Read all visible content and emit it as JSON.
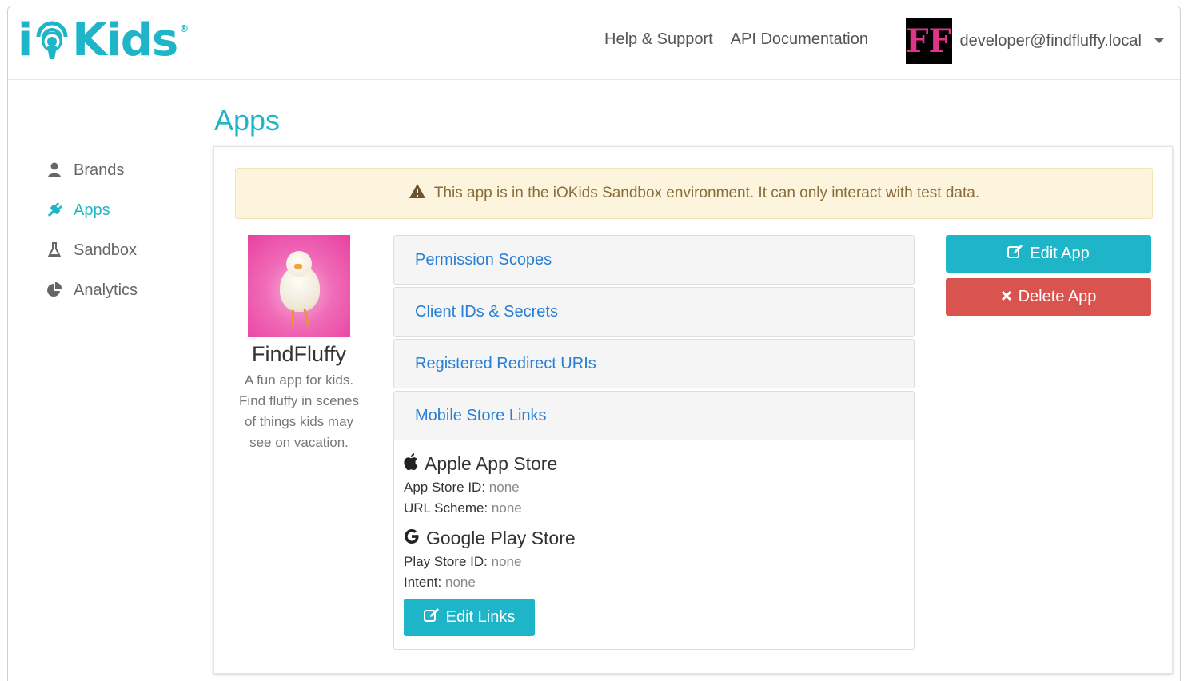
{
  "brand": {
    "logo_text_left": "i",
    "logo_text_right": "Kids",
    "logo_registered": "®",
    "accent_color": "#1fb5c8"
  },
  "header": {
    "links": [
      "Help & Support",
      "API Documentation"
    ],
    "avatar_text": "FF",
    "user_email": "developer@findfluffy.local"
  },
  "sidebar": {
    "items": [
      {
        "label": "Brands",
        "icon": "user-icon",
        "active": false
      },
      {
        "label": "Apps",
        "icon": "plug-icon",
        "active": true
      },
      {
        "label": "Sandbox",
        "icon": "flask-icon",
        "active": false
      },
      {
        "label": "Analytics",
        "icon": "pie-chart-icon",
        "active": false
      }
    ]
  },
  "page": {
    "title": "Apps"
  },
  "alert": {
    "icon": "warning-icon",
    "text": "This app is in the iOKids Sandbox environment. It can only interact with test data."
  },
  "app": {
    "name": "FindFluffy",
    "description": "A fun app for kids. Find fluffy in scenes of things kids may see on vacation."
  },
  "accordion": {
    "sections": [
      {
        "label": "Permission Scopes"
      },
      {
        "label": "Client IDs & Secrets"
      },
      {
        "label": "Registered Redirect URIs"
      },
      {
        "label": "Mobile Store Links"
      }
    ],
    "stores": {
      "apple": {
        "title": "Apple App Store",
        "icon": "apple-icon",
        "id_label": "App Store ID:",
        "id_value": "none",
        "scheme_label": "URL Scheme:",
        "scheme_value": "none"
      },
      "google": {
        "title": "Google Play Store",
        "icon": "google-icon",
        "id_label": "Play Store ID:",
        "id_value": "none",
        "intent_label": "Intent:",
        "intent_value": "none"
      }
    },
    "edit_links_label": "Edit Links"
  },
  "actions": {
    "edit_app_label": "Edit App",
    "delete_app_label": "Delete App",
    "delete_color": "#d9534f"
  }
}
